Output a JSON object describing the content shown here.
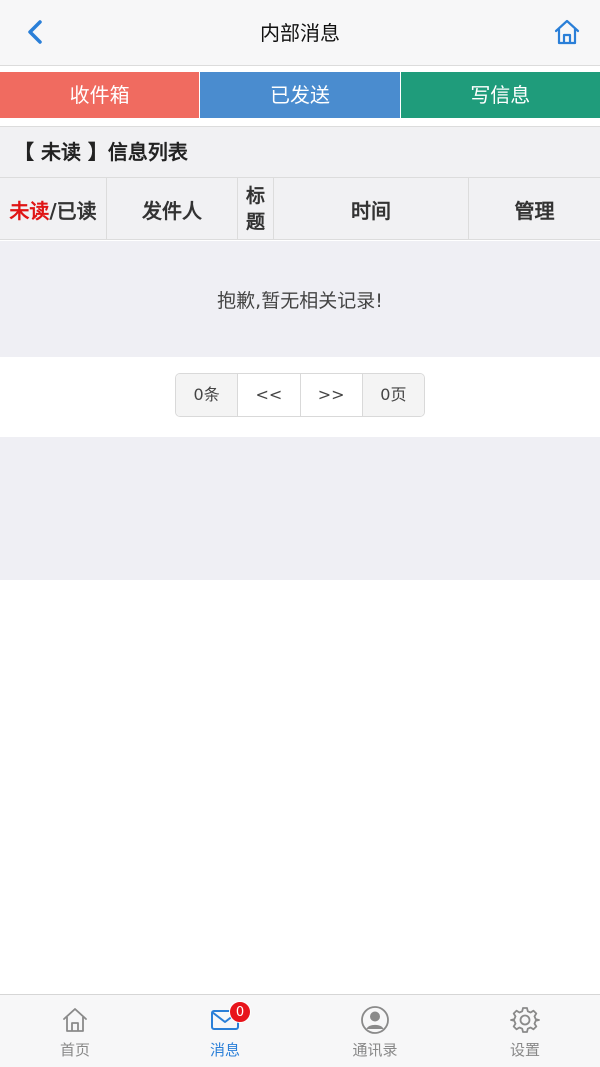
{
  "header": {
    "title": "内部消息",
    "back_icon": "chevron-left-icon",
    "home_icon": "home-icon"
  },
  "tabs": [
    {
      "label": "收件箱",
      "color": "#f06b60"
    },
    {
      "label": "已发送",
      "color": "#4a8ccf"
    },
    {
      "label": "写信息",
      "color": "#1f9c7b"
    }
  ],
  "list": {
    "title": "【 未读 】信息列表",
    "columns": {
      "read_unread_a": "未读",
      "read_unread_b": "/已读",
      "sender": "发件人",
      "subject": "标题",
      "time": "时间",
      "manage": "管理"
    },
    "empty_message": "抱歉,暂无相关记录!"
  },
  "pager": {
    "count": "0条",
    "prev": "<<",
    "next": ">>",
    "pages": "0页"
  },
  "bottom_nav": {
    "items": [
      {
        "label": "首页",
        "icon": "home-icon"
      },
      {
        "label": "消息",
        "icon": "mail-icon"
      },
      {
        "label": "通讯录",
        "icon": "contacts-icon"
      },
      {
        "label": "设置",
        "icon": "gear-icon"
      }
    ],
    "active_index": 1,
    "badge": "0"
  },
  "colors": {
    "accent": "#2a7fd8",
    "unread": "#e01515",
    "badge": "#e8141b"
  }
}
